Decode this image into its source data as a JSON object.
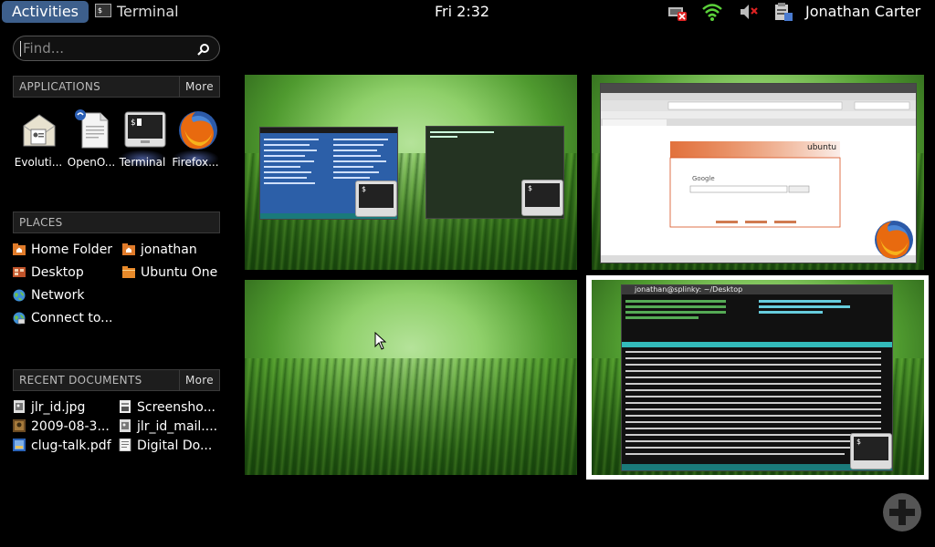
{
  "panel": {
    "activities": "Activities",
    "app_menu": "Terminal",
    "clock": "Fri  2:32",
    "user": "Jonathan Carter"
  },
  "search": {
    "placeholder": "Find..."
  },
  "applications": {
    "header": "APPLICATIONS",
    "more": "More",
    "items": [
      {
        "label": "Evoluti...",
        "icon": "evolution-mail-icon"
      },
      {
        "label": "OpenO...",
        "icon": "openoffice-document-icon"
      },
      {
        "label": "Terminal",
        "icon": "terminal-icon",
        "running": true
      },
      {
        "label": "Firefox...",
        "icon": "firefox-icon",
        "running": true
      }
    ]
  },
  "places": {
    "header": "PLACES",
    "items": [
      {
        "label": "Home Folder",
        "icon": "home-folder-icon"
      },
      {
        "label": "jonathan",
        "icon": "home-folder-icon"
      },
      {
        "label": "Desktop",
        "icon": "desktop-icon"
      },
      {
        "label": "Ubuntu One",
        "icon": "folder-icon"
      },
      {
        "label": "Network",
        "icon": "network-icon"
      },
      {
        "label": "Connect to...",
        "icon": "connect-server-icon"
      }
    ]
  },
  "recent": {
    "header": "RECENT DOCUMENTS",
    "more": "More",
    "items": [
      {
        "label": "jlr_id.jpg",
        "icon": "image-file-icon"
      },
      {
        "label": "Screensho...",
        "icon": "image-file-icon"
      },
      {
        "label": "2009-08-3...",
        "icon": "photo-file-icon"
      },
      {
        "label": "jlr_id_mail....",
        "icon": "image-file-icon"
      },
      {
        "label": "clug-talk.pdf",
        "icon": "pdf-file-icon"
      },
      {
        "label": "Digital Do...",
        "icon": "document-file-icon"
      }
    ]
  },
  "workspaces": [
    {
      "windows": [
        "Terminal",
        "Terminal"
      ]
    },
    {
      "windows": [
        "Ubuntu Start Page - Mozilla Firefox"
      ],
      "browser": {
        "logo_text": "ubuntu",
        "search_engine": "Google",
        "search_button": "Search"
      }
    },
    {
      "windows": []
    },
    {
      "windows": [
        "jonathan@splinky: ~/Desktop"
      ],
      "active": true
    }
  ],
  "colors": {
    "activities_bg": "#3d5f8c",
    "active_workspace_border": "#ffffff",
    "panel_bg": "#000000"
  }
}
